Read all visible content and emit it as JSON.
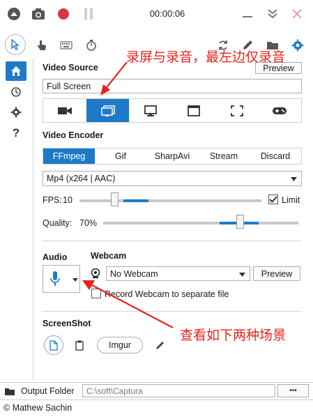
{
  "titlebar": {
    "timer": "00:00:06"
  },
  "video_source": {
    "title": "Video Source",
    "preview_label": "Preview",
    "selected_value": "Full Screen"
  },
  "video_encoder": {
    "title": "Video Encoder",
    "tabs": [
      "FFmpeg",
      "Gif",
      "SharpAvi",
      "Stream",
      "Discard"
    ],
    "active_tab": "FFmpeg",
    "codec": "Mp4 (x264 | AAC)",
    "fps_label": "FPS:",
    "fps_value": "10",
    "fps_level": 0.19,
    "limit_label": "Limit",
    "limit_checked": true,
    "quality_label": "Quality:",
    "quality_value": "70%",
    "quality_level": 0.7
  },
  "audio": {
    "title": "Audio"
  },
  "webcam": {
    "title": "Webcam",
    "selected": "No Webcam",
    "preview_label": "Preview",
    "separate_label": "Record Webcam to separate file",
    "separate_checked": false
  },
  "screenshot": {
    "title": "ScreenShot",
    "imgur_label": "Imgur"
  },
  "output": {
    "label": "Output Folder",
    "path": "C:\\soft\\Captura",
    "more_label": "•••"
  },
  "status": {
    "copyright": "© Mathew Sachin"
  },
  "annotations": {
    "top": "录屏与录音，最左边仅录音",
    "bottom": "查看如下两种场景"
  },
  "colors": {
    "accent": "#1e7ac8",
    "annotation": "#e8231c",
    "record": "#d9363e"
  }
}
